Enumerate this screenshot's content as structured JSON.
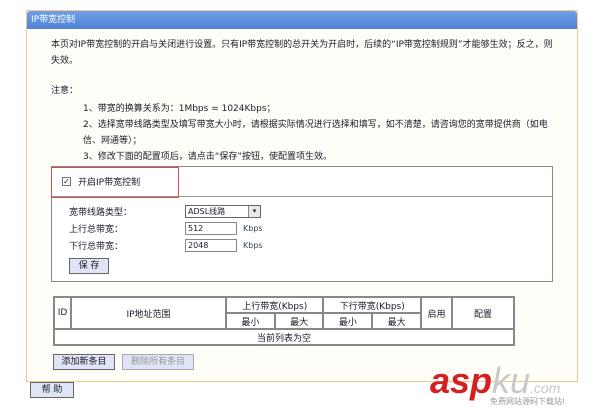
{
  "title": "IP带宽控制",
  "intro": "本页对IP带宽控制的开启与关闭进行设置。只有IP带宽控制的总开关为开启时，后续的“IP带宽控制规则”才能够生效；反之，则失效。",
  "notes_label": "注意：",
  "notes": [
    "1、带宽的换算关系为：1Mbps = 1024Kbps；",
    "2、选择宽带线路类型及填写带宽大小时，请根据实际情况进行选择和填写，如不清楚，请咨询您的宽带提供商（如电信、网通等）；",
    "3、修改下面的配置项后，请点击“保存”按钮，使配置项生效。"
  ],
  "enable": {
    "label": "开启IP带宽控制",
    "checked": true,
    "mark": "✓"
  },
  "line_type": {
    "label": "宽带线路类型：",
    "value": "ADSL线路",
    "arrow": "▾"
  },
  "up": {
    "label": "上行总带宽：",
    "value": "512",
    "unit": "Kbps"
  },
  "down": {
    "label": "下行总带宽：",
    "value": "2048",
    "unit": "Kbps"
  },
  "save": "保 存",
  "table": {
    "id": "ID",
    "ip": "IP地址范围",
    "up": "上行带宽(Kbps)",
    "down": "下行带宽(Kbps)",
    "enable": "启用",
    "config": "配置",
    "min": "最小",
    "max": "最大",
    "empty": "当前列表为空"
  },
  "add": "添加新条目",
  "delete_all": "删除所有条目",
  "help": "帮 助",
  "watermark": {
    "brand": "asp",
    "brand2": "ku",
    "suffix": ".com",
    "tagline": "免费网站源码下载站!"
  }
}
